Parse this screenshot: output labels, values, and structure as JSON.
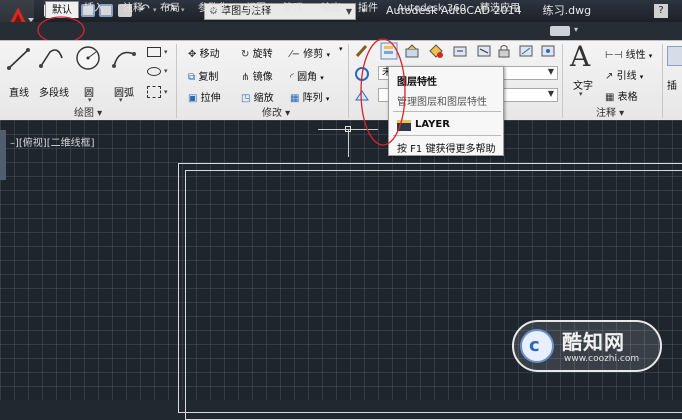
{
  "titlebar": {
    "workspace": "草图与注释",
    "app_title": "Autodesk AutoCAD 2014",
    "file_name": "练习.dwg",
    "help_label": "?"
  },
  "tabs": [
    {
      "label": "默认",
      "active": true
    },
    {
      "label": "插入"
    },
    {
      "label": "注释"
    },
    {
      "label": "布局"
    },
    {
      "label": "参数化"
    },
    {
      "label": "视图"
    },
    {
      "label": "管理"
    },
    {
      "label": "输出"
    },
    {
      "label": "插件"
    },
    {
      "label": "Autodesk 360"
    },
    {
      "label": "精选应用"
    }
  ],
  "draw_panel": {
    "title": "绘图 ▾",
    "line": "直线",
    "polyline": "多段线",
    "circle": "圆",
    "arc": "圆弧"
  },
  "modify_panel": {
    "title": "修改 ▾",
    "move": "移动",
    "rotate": "旋转",
    "trim": "修剪",
    "copy": "复制",
    "mirror": "镜像",
    "fillet": "圆角",
    "stretch": "拉伸",
    "scale": "缩放",
    "array": "阵列"
  },
  "layer_panel": {
    "combo_value": "未"
  },
  "annotation_panel": {
    "title": "注释 ▾",
    "text": "文字",
    "linear": "线性",
    "leader": "引线",
    "table": "表格",
    "insert": "插"
  },
  "tooltip": {
    "title": "图层特性",
    "description": "管理图层和图层特性",
    "command": "LAYER",
    "help": "按 F1 键获得更多帮助"
  },
  "viewport": {
    "label": "–][俯视][二维线框]"
  },
  "watermark": {
    "name": "酷知网",
    "url": "www.coozhi.com"
  },
  "colors": {
    "accent_red": "#c4211e",
    "highlight_circle": "#d8242a"
  }
}
